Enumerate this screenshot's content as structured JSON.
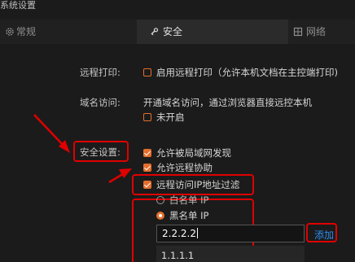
{
  "window": {
    "title": "系统设置"
  },
  "tabs": [
    {
      "label": "常规",
      "icon": "gear-icon",
      "active": false
    },
    {
      "label": "安全",
      "icon": "shield-key-icon",
      "active": true
    },
    {
      "label": "网络",
      "icon": "network-icon",
      "active": false
    }
  ],
  "remote_print": {
    "label": "远程打印:",
    "option": "启用远程打印（允许本机文档在主控端打印)",
    "checked": false
  },
  "domain_access": {
    "label": "域名访问:",
    "description": "开通域名访问，通过浏览器直接远控本机",
    "option": "未开启",
    "checked": false
  },
  "security": {
    "label": "安全设置:",
    "options": [
      {
        "label": "允许被局域网发现",
        "checked": true
      },
      {
        "label": "允许远程协助",
        "checked": true
      },
      {
        "label": "远程访问IP地址过滤",
        "checked": true
      }
    ],
    "ip_filter": {
      "modes": [
        {
          "label": "白名单 IP",
          "selected": false
        },
        {
          "label": "黑名单 IP",
          "selected": true
        }
      ],
      "input_value": "2.2.2.2",
      "add_label": "添加",
      "list": [
        "1.1.1.1"
      ]
    }
  },
  "colors": {
    "accent": "#e46f2d",
    "highlight_box": "#e00000",
    "link": "#2d8cf0",
    "background": "#1b1b1b"
  }
}
